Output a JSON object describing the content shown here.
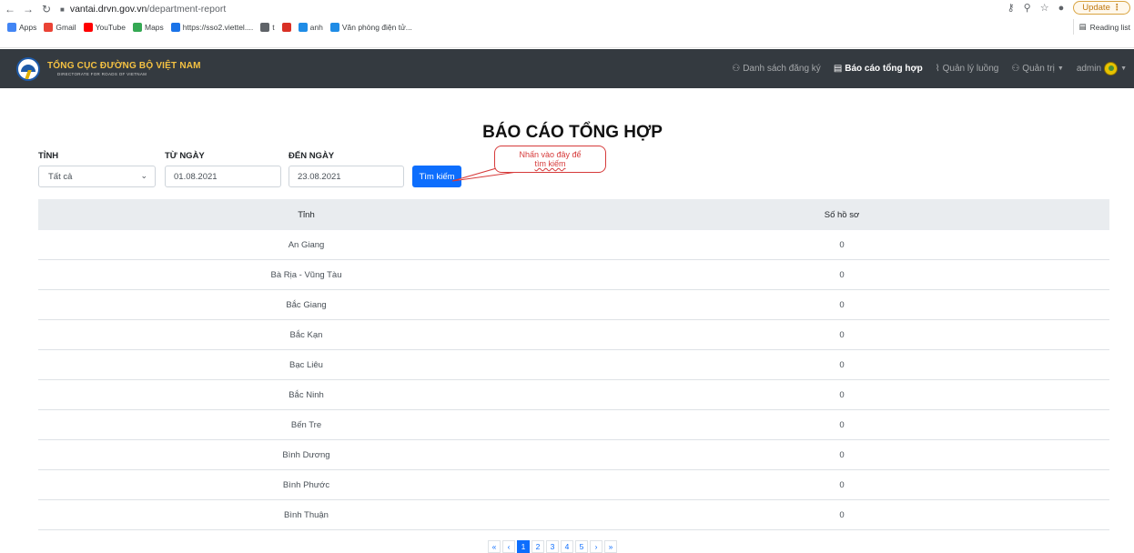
{
  "browser": {
    "url_host": "vantai.drvn.gov.vn",
    "url_path": "/department-report",
    "update_label": "Update",
    "reading_list": "Reading list",
    "bookmarks": [
      {
        "label": "Apps",
        "icon": "apps-grid-icon",
        "color": "#4285f4"
      },
      {
        "label": "Gmail",
        "icon": "gmail-icon",
        "color": "#ea4335"
      },
      {
        "label": "YouTube",
        "icon": "youtube-icon",
        "color": "#ff0000"
      },
      {
        "label": "Maps",
        "icon": "maps-pin-icon",
        "color": "#34a853"
      },
      {
        "label": "https://sso2.viettel....",
        "icon": "cloud-icon",
        "color": "#1a73e8"
      },
      {
        "label": "t",
        "icon": "globe-icon",
        "color": "#5f6368"
      },
      {
        "label": "",
        "icon": "circle-icon",
        "color": "#d93025"
      },
      {
        "label": "anh",
        "icon": "vuejs-icon",
        "color": "#1f8ce6"
      },
      {
        "label": "Văn phòng điện tử...",
        "icon": "vuejs-icon",
        "color": "#1f8ce6"
      }
    ]
  },
  "navbar": {
    "brand_title": "TỔNG CỤC ĐƯỜNG BỘ VIỆT NAM",
    "brand_subtitle": "DIRECTORATE FOR ROADS OF VIETNAM",
    "links": [
      {
        "label": "Danh sách đăng ký",
        "icon": "user-icon",
        "active": false
      },
      {
        "label": "Báo cáo tổng hợp",
        "icon": "report-icon",
        "active": true
      },
      {
        "label": "Quản lý luồng",
        "icon": "chart-line-icon",
        "active": false
      },
      {
        "label": "Quản trị",
        "icon": "user-icon",
        "active": false
      }
    ],
    "user": "admin"
  },
  "page": {
    "title": "BÁO CÁO TỔNG HỢP",
    "filters": {
      "province_label": "TỈNH",
      "province_value": "Tất cả",
      "from_label": "TỪ NGÀY",
      "from_value": "01.08.2021",
      "to_label": "ĐẾN NGÀY",
      "to_value": "23.08.2021",
      "search_label": "Tìm kiếm"
    },
    "callout": {
      "line1": "Nhấn vào đây để",
      "line2": "tìm kiếm"
    }
  },
  "table": {
    "headers": [
      "Tỉnh",
      "Số hồ sơ"
    ],
    "rows": [
      [
        "An Giang",
        "0"
      ],
      [
        "Bà Rịa - Vũng Tàu",
        "0"
      ],
      [
        "Bắc Giang",
        "0"
      ],
      [
        "Bắc Kạn",
        "0"
      ],
      [
        "Bạc Liêu",
        "0"
      ],
      [
        "Bắc Ninh",
        "0"
      ],
      [
        "Bến Tre",
        "0"
      ],
      [
        "Bình Dương",
        "0"
      ],
      [
        "Bình Phước",
        "0"
      ],
      [
        "Bình Thuận",
        "0"
      ]
    ]
  },
  "pagination": {
    "items": [
      "«",
      "‹",
      "1",
      "2",
      "3",
      "4",
      "5",
      "›",
      "»"
    ],
    "active": "1"
  }
}
